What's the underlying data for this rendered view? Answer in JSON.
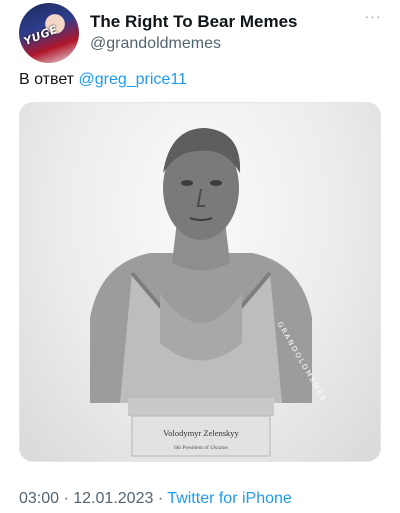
{
  "tweet": {
    "author_name": "The Right To Bear Memes",
    "author_handle": "@grandoldmemes",
    "avatar_badge": "YUGE",
    "more_label": "···",
    "reply_prefix": "В ответ",
    "reply_mention": "@greg_price11",
    "image": {
      "plaque_name": "Volodymyr Zelenskyy",
      "plaque_subtitle": "6th President of Ukraine",
      "watermark": "GRANDOLDMEMES"
    },
    "time": "03:00",
    "separator": "·",
    "date": "12.01.2023",
    "source": "Twitter for iPhone"
  },
  "colors": {
    "text": "#0f1419",
    "secondary": "#536471",
    "link": "#1d9bf0"
  }
}
